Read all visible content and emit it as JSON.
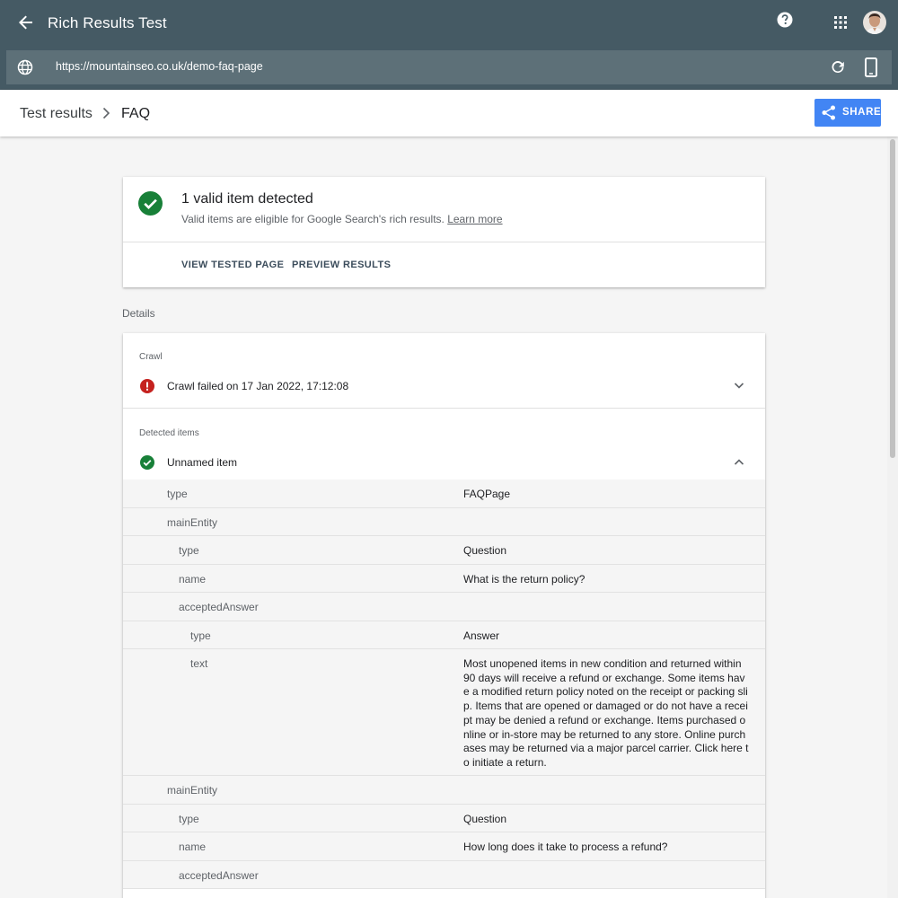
{
  "appbar": {
    "title": "Rich Results Test",
    "back_icon": "arrow-back-icon",
    "help_icon": "help-icon",
    "apps_icon": "apps-grid-icon",
    "avatar": "user-avatar",
    "bg_color": "#455a64"
  },
  "urlbar": {
    "url": "https://mountainseo.co.uk/demo-faq-page",
    "globe_icon": "globe-icon",
    "reload_icon": "reload-icon",
    "device_icon": "smartphone-icon"
  },
  "subheader": {
    "crumb_root": "Test results",
    "crumb_current": "FAQ",
    "share_label": "SHARE",
    "share_color": "#4285f4"
  },
  "summary": {
    "title": "1 valid item detected",
    "subtitle": "Valid items are eligible for Google Search's rich results. ",
    "learn_more": "Learn more",
    "view_tested_page": "VIEW TESTED PAGE",
    "preview_results": "PREVIEW RESULTS",
    "valid_color": "#188038"
  },
  "details": {
    "label": "Details",
    "crawl": {
      "label": "Crawl",
      "status": "Crawl failed on 17 Jan 2022, 17:12:08",
      "error_color": "#c5221f"
    },
    "detected": {
      "label": "Detected items",
      "item_name": "Unnamed item"
    },
    "properties": [
      {
        "key": "type",
        "value": "FAQPage",
        "level": 0
      },
      {
        "key": "mainEntity",
        "value": "",
        "level": 0
      },
      {
        "key": "type",
        "value": "Question",
        "level": 1
      },
      {
        "key": "name",
        "value": "What is the return policy?",
        "level": 1
      },
      {
        "key": "acceptedAnswer",
        "value": "",
        "level": 1
      },
      {
        "key": "type",
        "value": "Answer",
        "level": 2
      },
      {
        "key": "text",
        "value": "Most unopened items in new condition and returned within 90 days will receive a refund or exchange. Some items have a modified return policy noted on the receipt or packing slip. Items that are opened or damaged or do not have a receipt may be denied a refund or exchange. Items purchased online or in-store may be returned to any store. Online purchases may be returned via a major parcel carrier. Click here to initiate a return.",
        "level": 2
      },
      {
        "key": "mainEntity",
        "value": "",
        "level": 0
      },
      {
        "key": "type",
        "value": "Question",
        "level": 1
      },
      {
        "key": "name",
        "value": "How long does it take to process a refund?",
        "level": 1
      },
      {
        "key": "acceptedAnswer",
        "value": "",
        "level": 1
      }
    ]
  }
}
